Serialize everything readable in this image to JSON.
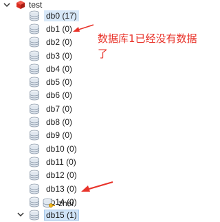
{
  "root": {
    "label": "test",
    "icon": "redis-cube-icon"
  },
  "databases": [
    {
      "label": "db0 (17)",
      "state": "selected-soft"
    },
    {
      "label": "db1 (0)",
      "state": "normal"
    },
    {
      "label": "db2 (0)",
      "state": "normal"
    },
    {
      "label": "db3 (0)",
      "state": "normal"
    },
    {
      "label": "db4 (0)",
      "state": "normal"
    },
    {
      "label": "db5 (0)",
      "state": "normal"
    },
    {
      "label": "db6 (0)",
      "state": "normal"
    },
    {
      "label": "db7 (0)",
      "state": "normal"
    },
    {
      "label": "db8 (0)",
      "state": "normal"
    },
    {
      "label": "db9 (0)",
      "state": "normal"
    },
    {
      "label": "db10 (0)",
      "state": "normal"
    },
    {
      "label": "db11 (0)",
      "state": "normal"
    },
    {
      "label": "db12 (0)",
      "state": "normal"
    },
    {
      "label": "db13 (0)",
      "state": "normal"
    },
    {
      "label": "db14 (0)",
      "state": "normal"
    },
    {
      "label": "db15 (1)",
      "state": "selected",
      "expanded": true
    }
  ],
  "keys": [
    {
      "label": "zhai",
      "icon": "key-icon"
    }
  ],
  "annotation": {
    "text": "数据库1已经没有数据了",
    "color": "#e8332a"
  },
  "colors": {
    "selection": "#cfe3f7",
    "selection_border": "#a9c9ea",
    "redis": "#d82c20",
    "arrow": "#e8332a"
  }
}
